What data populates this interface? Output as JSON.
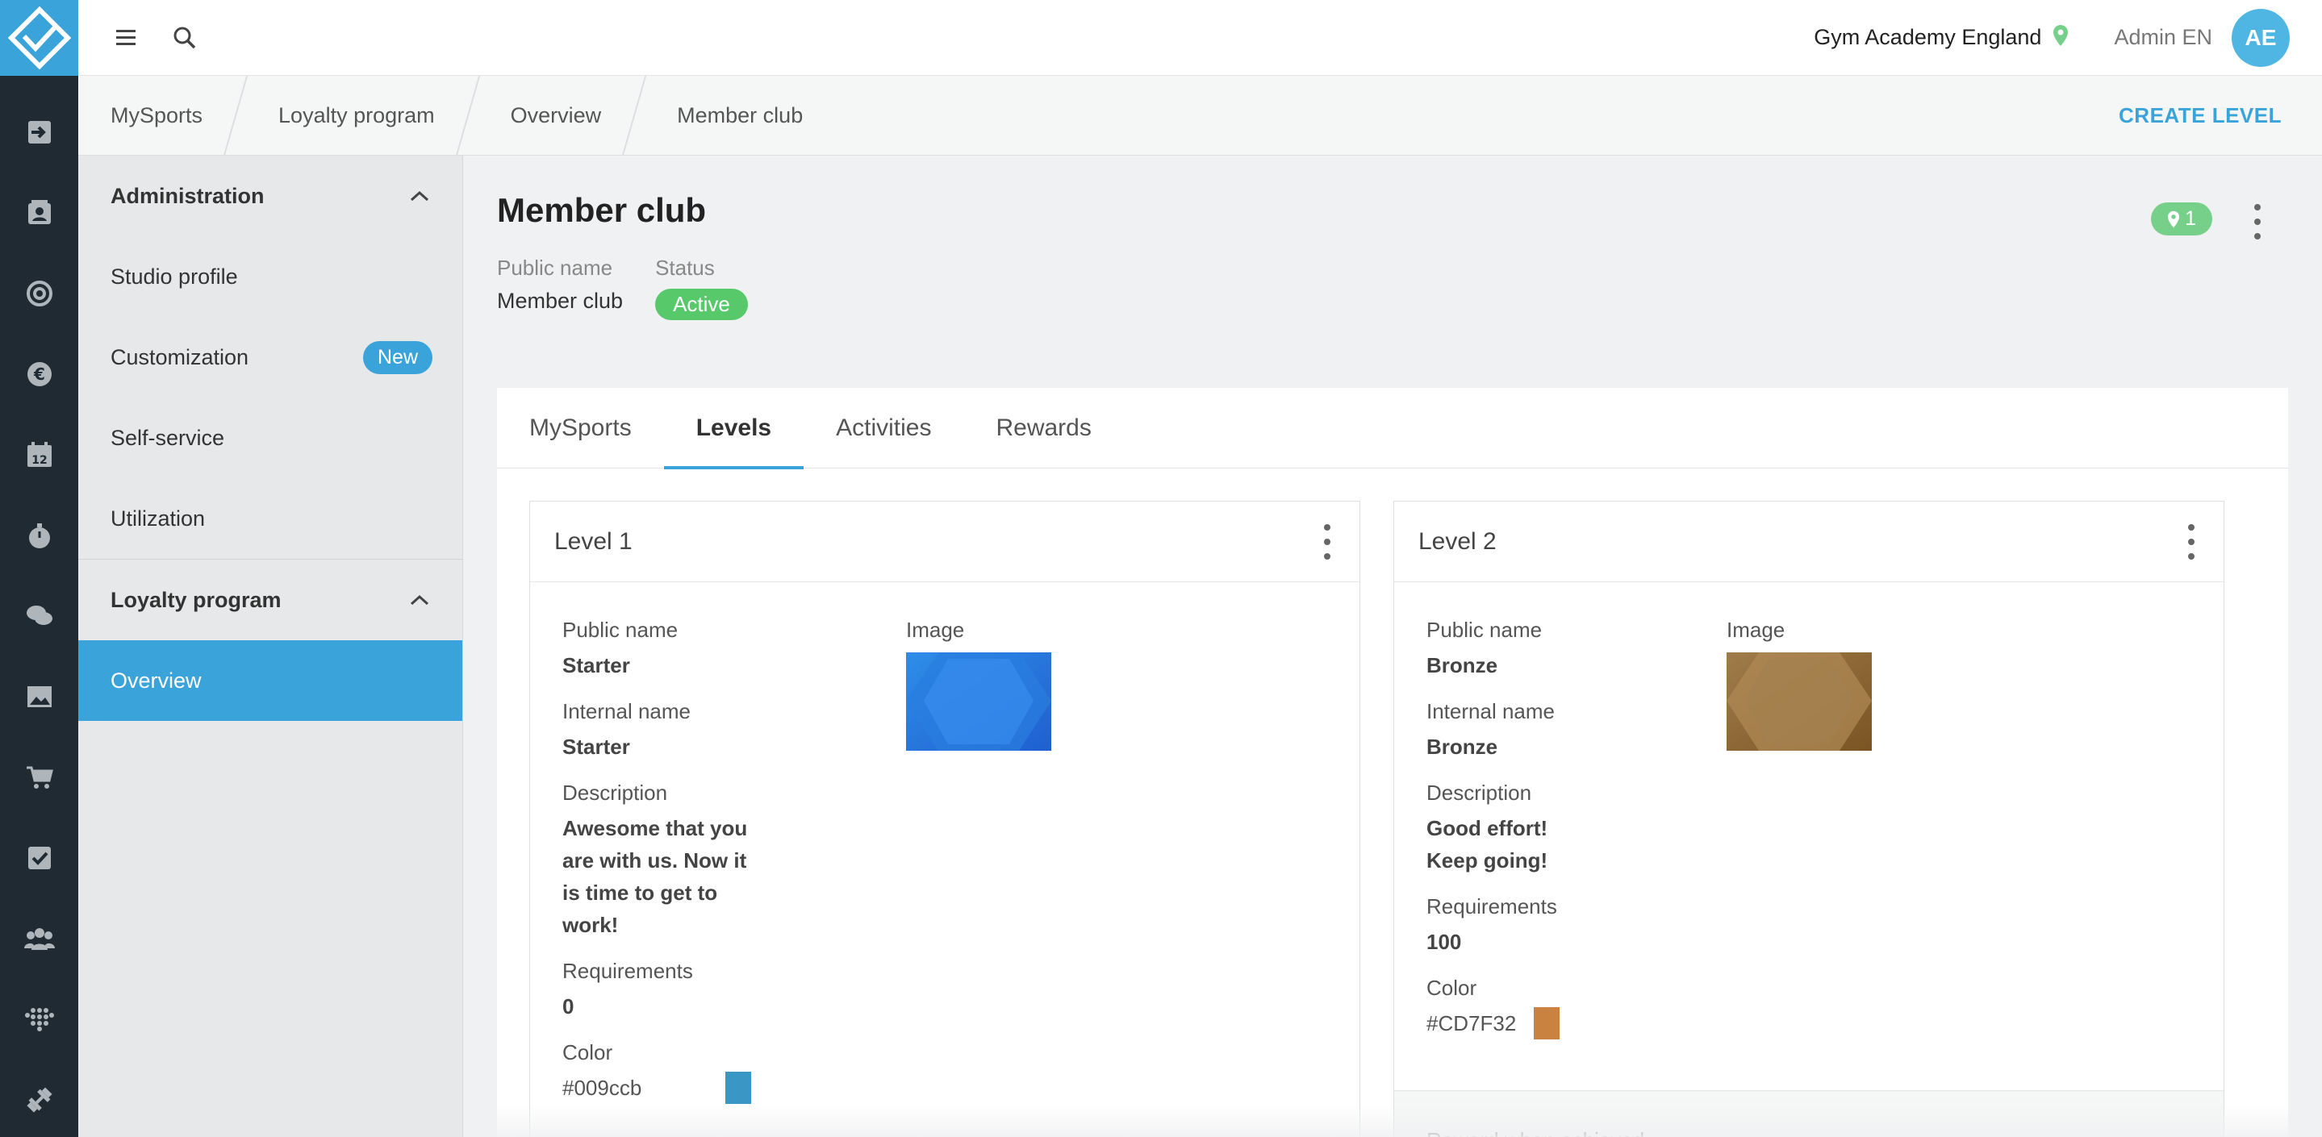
{
  "topbar": {
    "studio_name": "Gym Academy England",
    "user_name": "Admin EN",
    "avatar_initials": "AE"
  },
  "breadcrumb": [
    "MySports",
    "Loyalty program",
    "Overview",
    "Member club"
  ],
  "actions": {
    "create_level": "CREATE LEVEL"
  },
  "sidebar": {
    "sections": [
      {
        "title": "Administration",
        "items": [
          {
            "label": "Studio profile"
          },
          {
            "label": "Customization",
            "badge": "New"
          },
          {
            "label": "Self-service"
          },
          {
            "label": "Utilization"
          }
        ]
      },
      {
        "title": "Loyalty program",
        "items": [
          {
            "label": "Overview",
            "active": true
          }
        ]
      }
    ]
  },
  "page": {
    "title": "Member club",
    "public_name_label": "Public name",
    "public_name_value": "Member club",
    "status_label": "Status",
    "status_value": "Active",
    "location_count": "1"
  },
  "tabs": [
    "MySports",
    "Levels",
    "Activities",
    "Rewards"
  ],
  "levels": [
    {
      "title": "Level 1",
      "public_name_label": "Public name",
      "public_name": "Starter",
      "internal_name_label": "Internal name",
      "internal_name": "Starter",
      "description_label": "Description",
      "description": "Awesome that you are with us. Now it is time to get to work!",
      "requirements_label": "Requirements",
      "requirements": "0",
      "color_label": "Color",
      "color": "#009ccb",
      "image_label": "Image"
    },
    {
      "title": "Level 2",
      "public_name_label": "Public name",
      "public_name": "Bronze",
      "internal_name_label": "Internal name",
      "internal_name": "Bronze",
      "description_label": "Description",
      "description": "Good effort! Keep going!",
      "requirements_label": "Requirements",
      "requirements": "100",
      "color_label": "Color",
      "color": "#CD7F32",
      "image_label": "Image",
      "reward_label": "Reward when achieved"
    }
  ],
  "colors": {
    "accent": "#3aa3d9",
    "rail": "#1f2a33",
    "active_green": "#57c96b",
    "level1_swatch": "#3a96c4",
    "level2_swatch": "#c98240"
  },
  "icons": {
    "rail": [
      "check-in-icon",
      "contacts-icon",
      "target-icon",
      "euro-icon",
      "calendar-icon",
      "stopwatch-icon",
      "chat-icon",
      "image-icon",
      "cart-icon",
      "checkbox-icon",
      "group-icon",
      "dots-grid-icon",
      "dumbbell-icon"
    ]
  }
}
